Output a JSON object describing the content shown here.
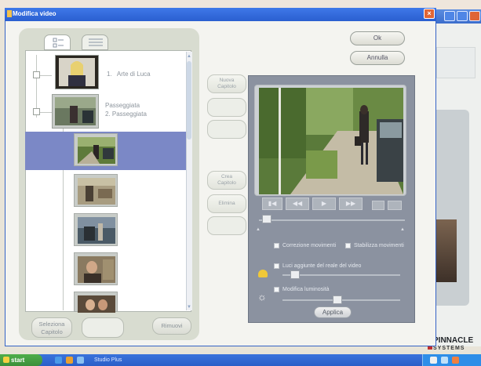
{
  "window": {
    "title": "Modifica video",
    "close_glyph": "×"
  },
  "tree": {
    "items": [
      {
        "number": "1.",
        "label": "Arte di Luca"
      },
      {
        "title": "Passeggiata",
        "subtitle": "2.   Passeggiata"
      }
    ]
  },
  "left_buttons": {
    "select_label": "Seleziona\nCapitolo",
    "middle_label": "",
    "right_label": "Rimuovi"
  },
  "mid_buttons": {
    "first_label": "Nuova\nCapitolo",
    "second_label": "Crea\nCapitolo",
    "third_label": "Elimina"
  },
  "top_buttons": {
    "ok_label": "Ok",
    "cancel_label": "Annulla"
  },
  "controls": {
    "prev": "▮◀",
    "rew": "◀◀",
    "play": "▶",
    "ffw": "▶▶"
  },
  "options": {
    "opt1": "Correzione movimenti",
    "opt2": "Stabilizza movimenti",
    "opt3": "Luci aggiunte del reale del video",
    "opt4": "Modifica luminosità",
    "apply_label": "Applica"
  },
  "taskbar": {
    "start_label": "start",
    "task_label": "Studio Plus"
  },
  "brand": {
    "name": "PINNACLE",
    "tagline": "SYSTEMS"
  }
}
